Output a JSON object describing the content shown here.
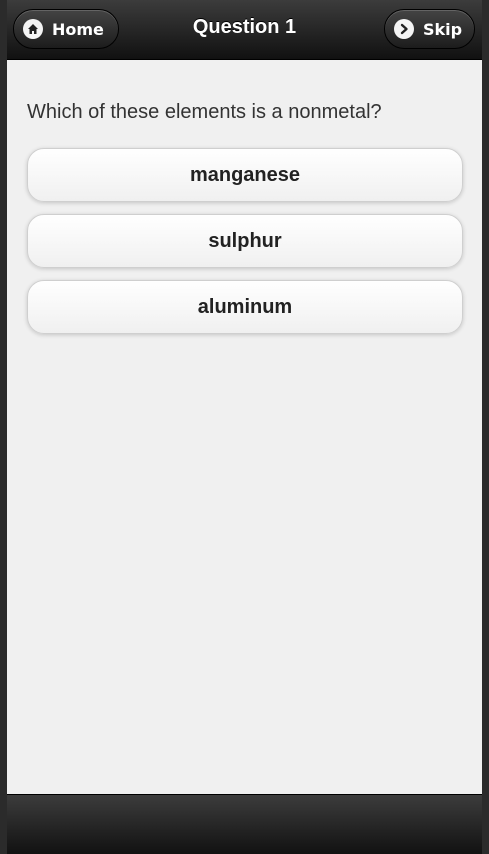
{
  "header": {
    "title": "Question 1",
    "home_label": "Home",
    "skip_label": "Skip",
    "home_icon": "home-icon",
    "skip_icon": "chevron-right-icon"
  },
  "question": {
    "text": "Which of these elements is a nonmetal?",
    "answers": [
      "manganese",
      "sulphur",
      "aluminum"
    ]
  },
  "colors": {
    "bar": "#1e1e1e",
    "background": "#f0f0f0",
    "button": "#f7f7f7"
  }
}
